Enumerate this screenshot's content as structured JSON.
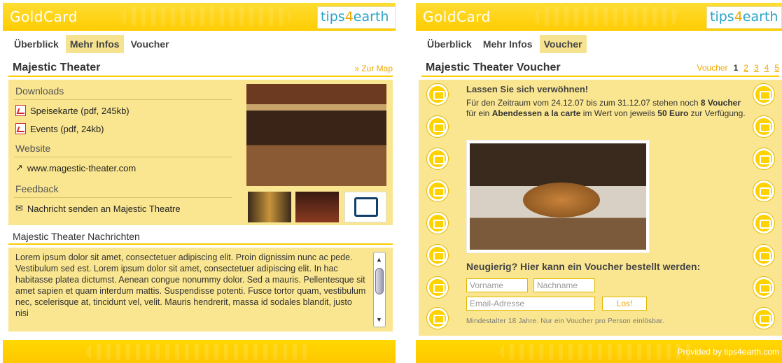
{
  "left": {
    "logo": "GoldCard",
    "brand_a": "tips",
    "brand_b": "4",
    "brand_c": "earth",
    "tabs": [
      "Überblick",
      "Mehr Infos",
      "Voucher"
    ],
    "title": "Majestic Theater",
    "map_link": "» Zur Map",
    "downloads_heading": "Downloads",
    "downloads": [
      "Speisekarte (pdf, 245kb)",
      "Events (pdf, 24kb)"
    ],
    "website_heading": "Website",
    "website": "www.magestic-theater.com",
    "feedback_heading": "Feedback",
    "feedback": "Nachricht senden an Majestic Theatre",
    "news_heading": "Majestic Theater Nachrichten",
    "news_text": "Lorem ipsum dolor sit amet, consectetuer adipiscing elit. Proin dignissim nunc ac pede. Vestibulum sed est. Lorem ipsum dolor sit amet, consectetuer adipiscing elit. In hac habitasse platea dictumst. Aenean congue nonummy dolor. Sed a mauris. Pellentesque sit amet sapien et quam interdum mattis. Suspendisse potenti. Fusce tortor quam, vestibulum nec, scelerisque at, tincidunt vel, velit. Mauris hendrerit, massa id sodales blandit, justo nisi"
  },
  "right": {
    "logo": "GoldCard",
    "brand_a": "tips",
    "brand_b": "4",
    "brand_c": "earth",
    "tabs": [
      "Überblick",
      "Mehr Infos",
      "Voucher"
    ],
    "title": "Majestic Theater Voucher",
    "pager_label": "Voucher",
    "pager": [
      "1",
      "2",
      "3",
      "4",
      "5"
    ],
    "headline": "Lassen Sie sich verwöhnen!",
    "desc_1": "Für den Zeitraum vom 24.12.07 bis zum 31.12.07 stehen noch",
    "desc_count": "8",
    "desc_2": "Voucher",
    "desc_3": "für ein",
    "desc_4": "Abendessen a la carte",
    "desc_5": "im Wert von jeweils",
    "desc_6": "50 Euro",
    "desc_7": "zur Verfügung.",
    "order_heading": "Neugierig? Hier kann ein Voucher bestellt werden:",
    "ph_first": "Vorname",
    "ph_last": "Nachname",
    "ph_email": "Email-Adresse",
    "submit": "Los!",
    "note": "Mindestalter 18 Jahre. Nur ein Voucher pro Person einlösbar.",
    "footer": "Provided by tips4earth.com"
  }
}
